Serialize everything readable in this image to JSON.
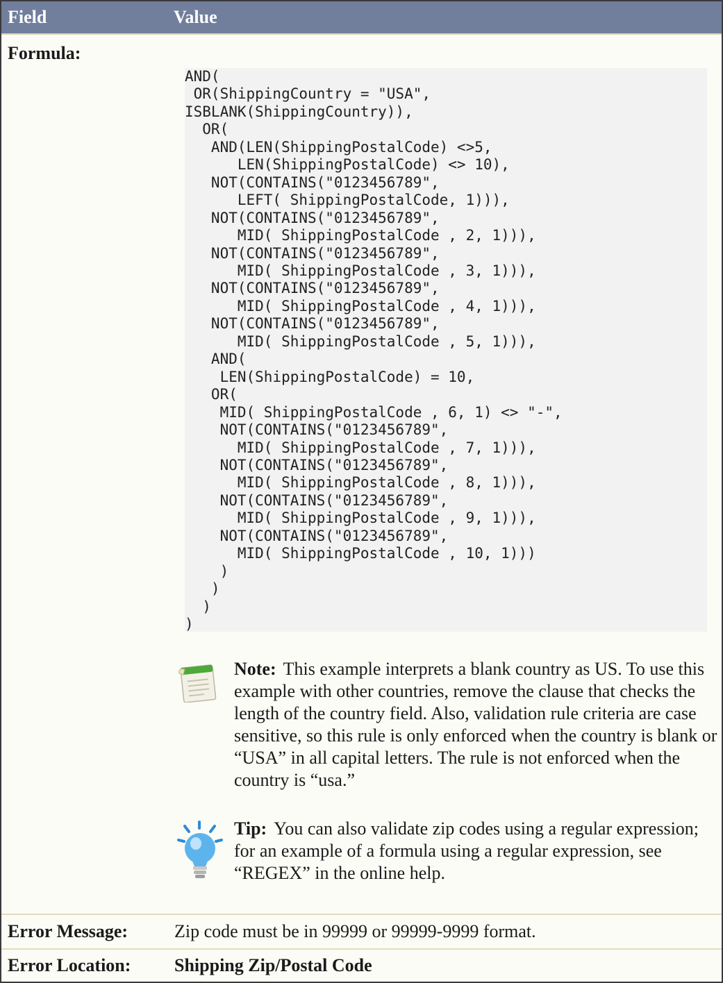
{
  "header": {
    "field_label": "Field",
    "value_label": "Value"
  },
  "rows": {
    "formula": {
      "label": "Formula:",
      "code": "AND(\n OR(ShippingCountry = \"USA\",\nISBLANK(ShippingCountry)),\n  OR(\n   AND(LEN(ShippingPostalCode) <>5,\n      LEN(ShippingPostalCode) <> 10),\n   NOT(CONTAINS(\"0123456789\",\n      LEFT( ShippingPostalCode, 1))),\n   NOT(CONTAINS(\"0123456789\",\n      MID( ShippingPostalCode , 2, 1))),\n   NOT(CONTAINS(\"0123456789\",\n      MID( ShippingPostalCode , 3, 1))),\n   NOT(CONTAINS(\"0123456789\",\n      MID( ShippingPostalCode , 4, 1))),\n   NOT(CONTAINS(\"0123456789\",\n      MID( ShippingPostalCode , 5, 1))),\n   AND(\n    LEN(ShippingPostalCode) = 10,\n   OR(\n    MID( ShippingPostalCode , 6, 1) <> \"-\",\n    NOT(CONTAINS(\"0123456789\",\n      MID( ShippingPostalCode , 7, 1))),\n    NOT(CONTAINS(\"0123456789\",\n      MID( ShippingPostalCode , 8, 1))),\n    NOT(CONTAINS(\"0123456789\",\n      MID( ShippingPostalCode , 9, 1))),\n    NOT(CONTAINS(\"0123456789\",\n      MID( ShippingPostalCode , 10, 1)))\n    )\n   )\n  )\n)",
      "note": {
        "icon": "note-icon",
        "lead": "Note:",
        "text": "This example interprets a blank country as US. To use this example with other countries, remove the clause that checks the length of the country field. Also, validation rule criteria are case sensitive, so this rule is only enforced when the country is blank or “USA” in all capital letters. The rule is not enforced when the country is “usa.”"
      },
      "tip": {
        "icon": "lightbulb-icon",
        "lead": "Tip:",
        "text": "You can also validate zip codes using a regular expression; for an example of a formula using a regular expression, see “REGEX” in the online help."
      }
    },
    "error_message": {
      "label": "Error Message:",
      "value": "Zip code must be in 99999 or 99999-9999 format."
    },
    "error_location": {
      "label": "Error Location:",
      "value": "Shipping Zip/Postal Code"
    }
  },
  "colors": {
    "header_bg": "#717f9c",
    "row_bg": "#fcfcf6",
    "code_bg": "#f2f2f2",
    "separator": "#e3dcc0"
  }
}
